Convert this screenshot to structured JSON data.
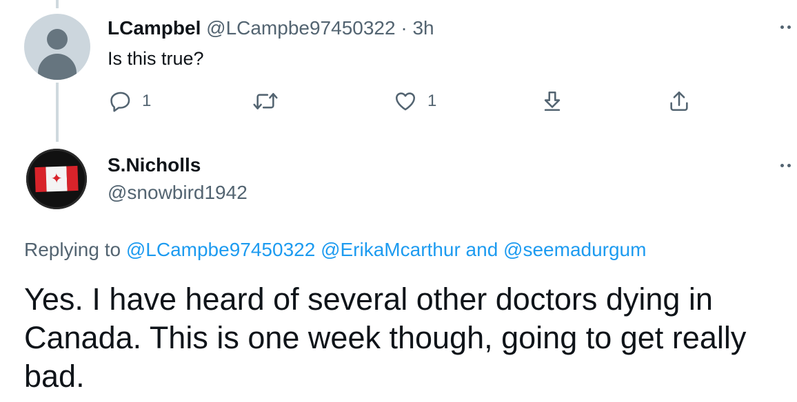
{
  "reply_tweet": {
    "display_name": "LCampbel",
    "handle": "@LCampbe97450322",
    "separator": "·",
    "timestamp": "3h",
    "text": "Is this true?",
    "actions": {
      "reply_count": "1",
      "retweet_count": "",
      "like_count": "1"
    }
  },
  "main_tweet": {
    "display_name": "S.Nicholls",
    "handle": "@snowbird1942",
    "replying_prefix": "Replying to",
    "replying_handles": [
      "@LCampbe97450322",
      "@ErikaMcarthur"
    ],
    "replying_and": "and",
    "replying_last": "@seemadurgum",
    "text": "Yes. I have heard of several other doctors dying in Canada. This is one week though, going to get really bad."
  },
  "colors": {
    "link": "#1d9bf0",
    "muted": "#536471",
    "text": "#0f1419",
    "thread_line": "#cfd9de"
  },
  "icons": [
    "reply-icon",
    "retweet-icon",
    "like-icon",
    "share-icon",
    "upload-icon",
    "more-icon",
    "default-avatar-icon",
    "canada-flag-avatar"
  ]
}
